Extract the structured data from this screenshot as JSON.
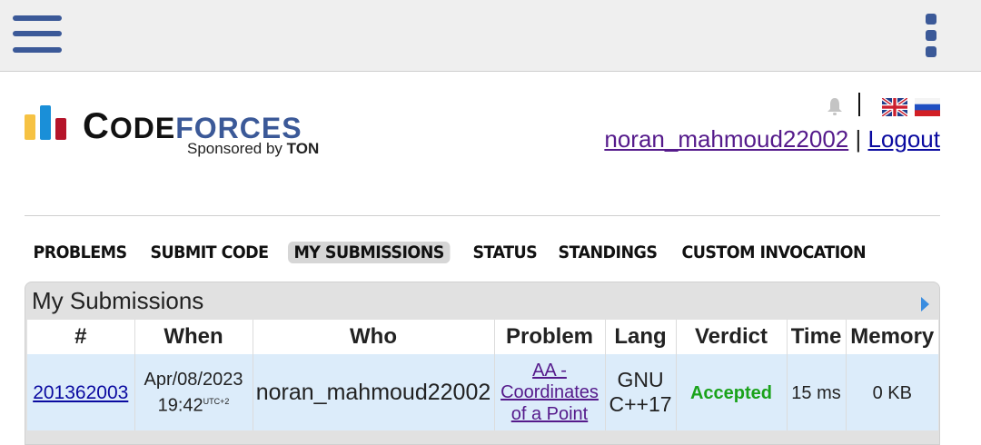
{
  "topbar": {
    "menu_icon": "hamburger-menu-icon",
    "more_icon": "more-vertical-icon"
  },
  "header": {
    "logo_code_first": "C",
    "logo_code_rest": "ODE",
    "logo_forces": "FORCES",
    "sponsor_prefix": "Sponsored by ",
    "sponsor_name": "TON",
    "username": "noran_mahmoud22002",
    "separator": "|",
    "logout": "Logout"
  },
  "menu": {
    "items": [
      {
        "label": "PROBLEMS"
      },
      {
        "label": "SUBMIT CODE"
      },
      {
        "label": "MY SUBMISSIONS"
      },
      {
        "label": "STATUS"
      },
      {
        "label": "STANDINGS"
      },
      {
        "label": "CUSTOM INVOCATION"
      }
    ],
    "active": "MY SUBMISSIONS"
  },
  "submissions": {
    "title": "My Submissions",
    "columns": [
      "#",
      "When",
      "Who",
      "Problem",
      "Lang",
      "Verdict",
      "Time",
      "Memory"
    ],
    "rows": [
      {
        "id": "201362003",
        "date": "Apr/08/2023",
        "time": "19:42",
        "tz": "UTC+2",
        "who": "noran_mahmoud22002",
        "problem_line1": "AA -",
        "problem_line2": "Coordinates",
        "problem_line3": "of a Point",
        "lang_line1": "GNU",
        "lang_line2": "C++17",
        "verdict": "Accepted",
        "exec_time": "15 ms",
        "memory": "0 KB"
      }
    ]
  },
  "colors": {
    "brand_blue": "#3b5998",
    "accepted_green": "#1aa21a",
    "row_bg": "#dcecfa",
    "link_blue": "#0a0aa0",
    "visited_purple": "#551a8b"
  }
}
